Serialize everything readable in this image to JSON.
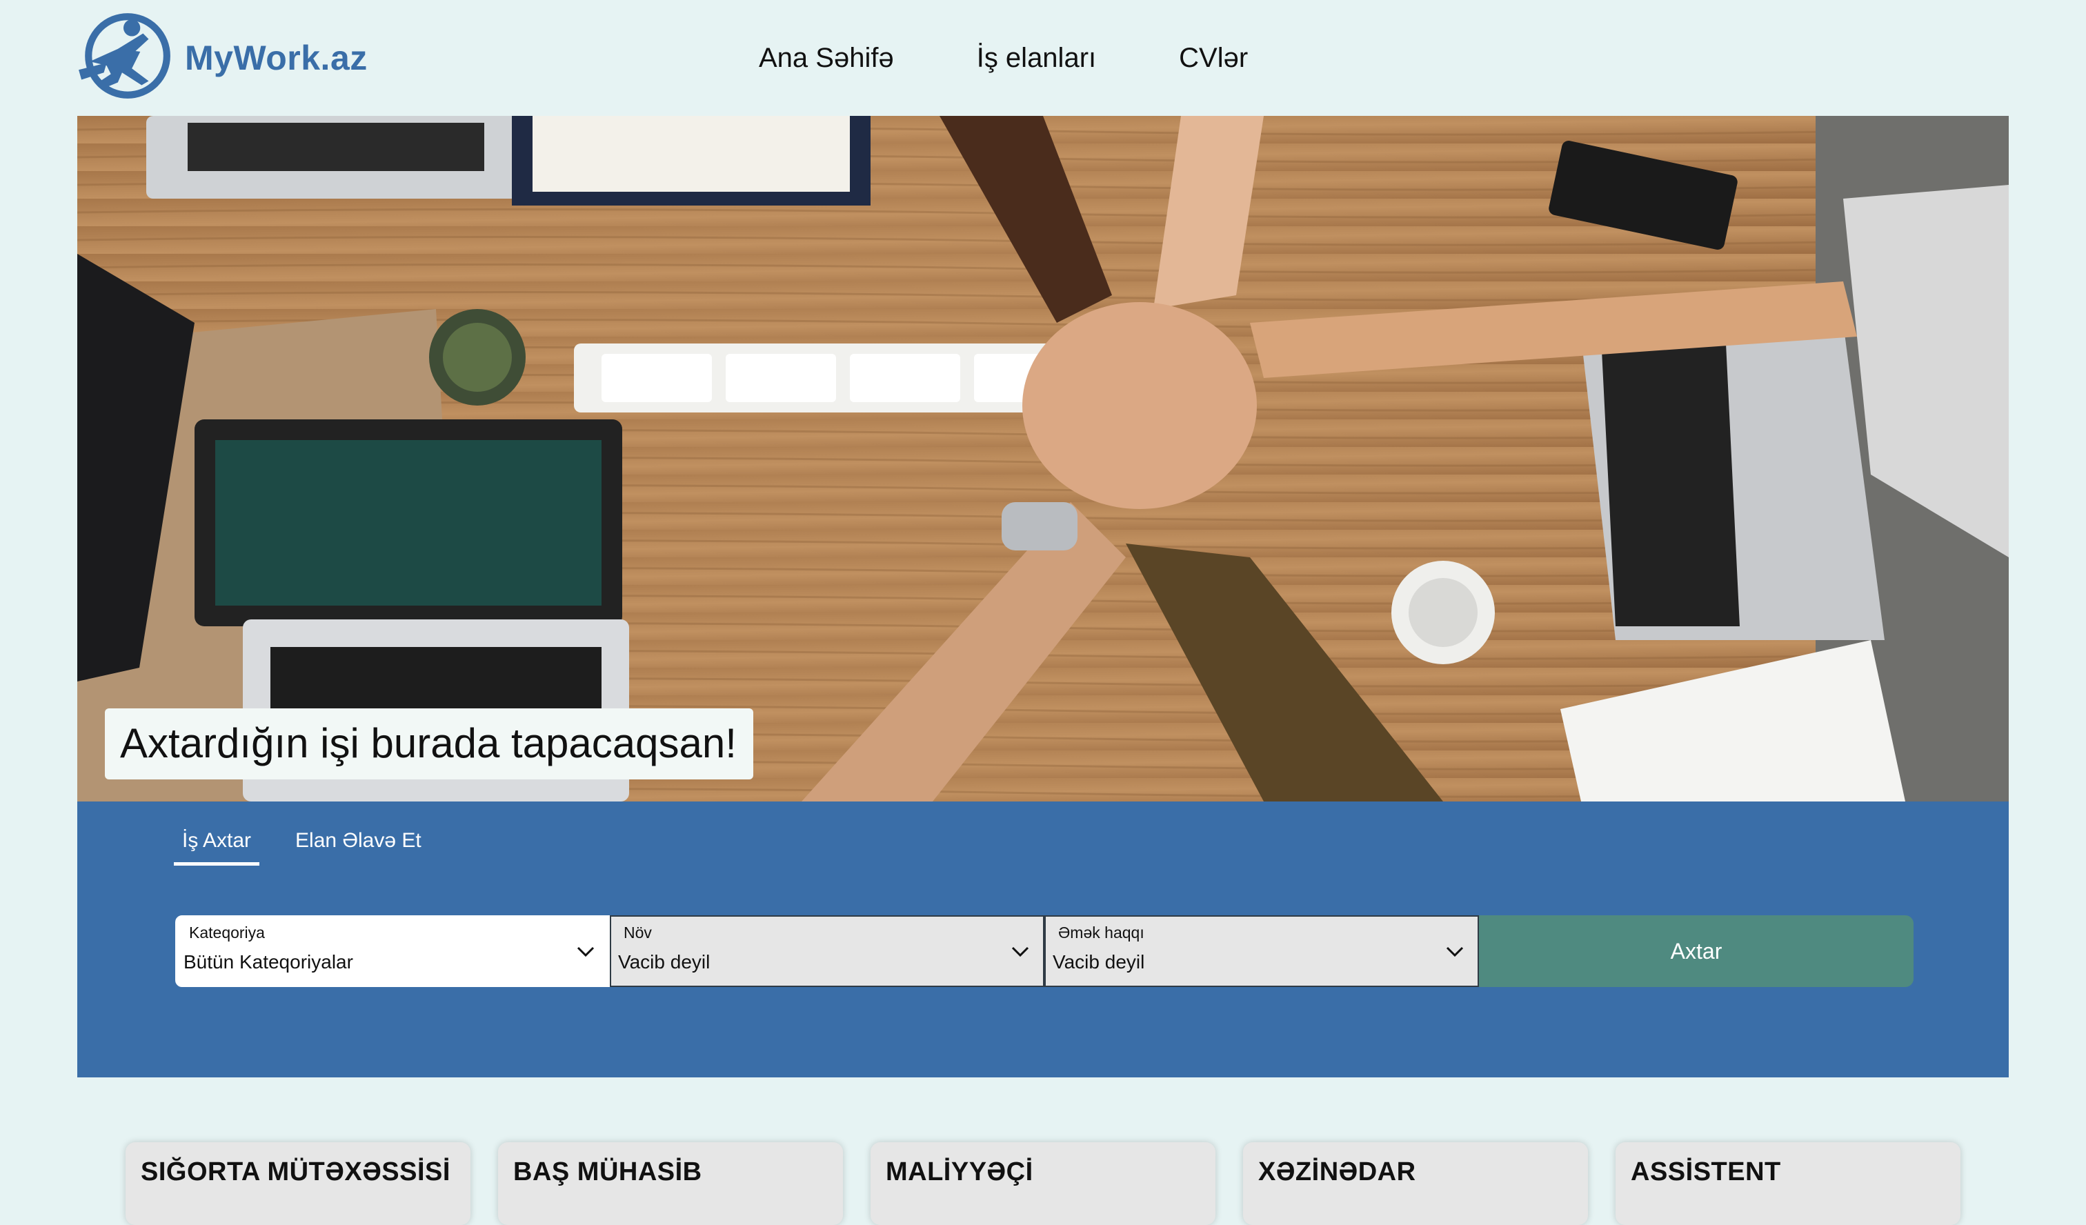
{
  "header": {
    "logo_text": "MyWork.az",
    "nav": [
      "Ana Səhifə",
      "İş elanları",
      "CVlər"
    ]
  },
  "hero": {
    "caption": "Axtardığın işi burada tapacaqsan!"
  },
  "search": {
    "tabs": [
      "İş Axtar",
      "Elan Əlavə Et"
    ],
    "active_tab": "İş Axtar",
    "fields": [
      {
        "label": "Kateqoriya",
        "value": "Bütün Kateqoriyalar"
      },
      {
        "label": "Növ",
        "value": "Vacib deyil"
      },
      {
        "label": "Əmək haqqı",
        "value": "Vacib deyil"
      }
    ],
    "button_label": "Axtar"
  },
  "job_cards": [
    "SIĞORTA MÜTƏXƏSSİSİ",
    "BAŞ MÜHASİB",
    "MALİYYƏÇİ",
    "XƏZİNƏDAR",
    "ASSİSTENT"
  ],
  "colors": {
    "page_bg": "#e6f3f3",
    "brand_blue": "#3a6ea8",
    "search_button": "#4f8a80"
  }
}
